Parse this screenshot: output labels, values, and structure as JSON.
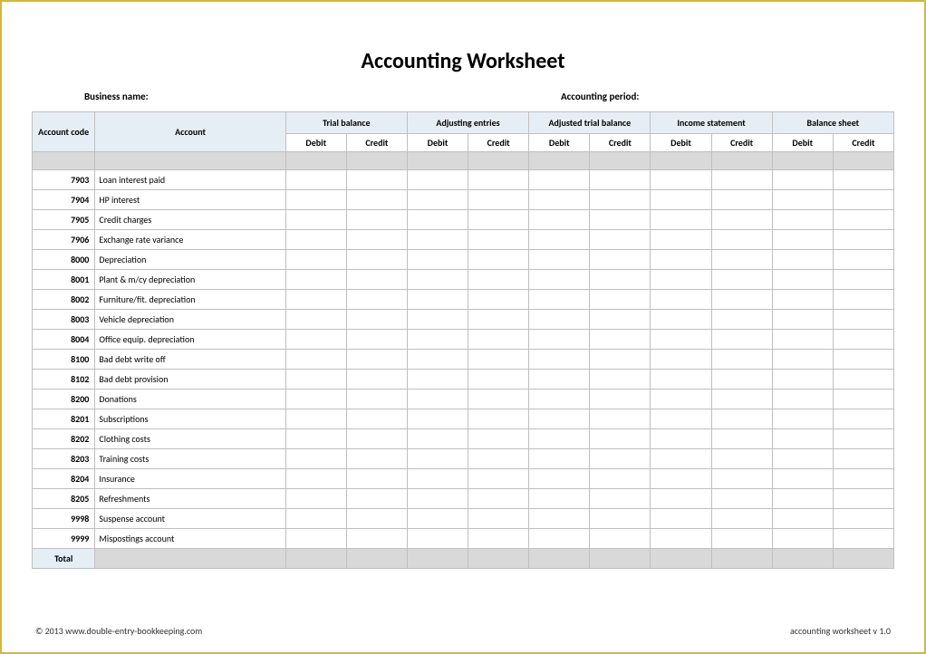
{
  "title": "Accounting Worksheet",
  "business_name_label": "Business name:",
  "accounting_period_label": "Accounting period:",
  "columns": {
    "account_code": "Account code",
    "account": "Account",
    "groups": [
      {
        "label": "Trial balance",
        "debit": "Debit",
        "credit": "Credit"
      },
      {
        "label": "Adjusting entries",
        "debit": "Debit",
        "credit": "Credit"
      },
      {
        "label": "Adjusted trial balance",
        "debit": "Debit",
        "credit": "Credit"
      },
      {
        "label": "Income statement",
        "debit": "Debit",
        "credit": "Credit"
      },
      {
        "label": "Balance sheet",
        "debit": "Debit",
        "credit": "Credit"
      }
    ]
  },
  "rows": [
    {
      "code": "7903",
      "name": "Loan interest paid"
    },
    {
      "code": "7904",
      "name": "HP interest"
    },
    {
      "code": "7905",
      "name": "Credit charges"
    },
    {
      "code": "7906",
      "name": "Exchange rate variance"
    },
    {
      "code": "8000",
      "name": "Depreciation"
    },
    {
      "code": "8001",
      "name": "Plant & m/cy depreciation"
    },
    {
      "code": "8002",
      "name": "Furniture/fit. depreciation"
    },
    {
      "code": "8003",
      "name": "Vehicle depreciation"
    },
    {
      "code": "8004",
      "name": "Office equip. depreciation"
    },
    {
      "code": "8100",
      "name": "Bad debt write off"
    },
    {
      "code": "8102",
      "name": "Bad debt provision"
    },
    {
      "code": "8200",
      "name": "Donations"
    },
    {
      "code": "8201",
      "name": "Subscriptions"
    },
    {
      "code": "8202",
      "name": "Clothing costs"
    },
    {
      "code": "8203",
      "name": "Training costs"
    },
    {
      "code": "8204",
      "name": "Insurance"
    },
    {
      "code": "8205",
      "name": "Refreshments"
    },
    {
      "code": "9998",
      "name": "Suspense account"
    },
    {
      "code": "9999",
      "name": "Mispostings account"
    }
  ],
  "total_label": "Total",
  "footer_left": "© 2013 www.double-entry-bookkeeping.com",
  "footer_right": "accounting worksheet v 1.0"
}
